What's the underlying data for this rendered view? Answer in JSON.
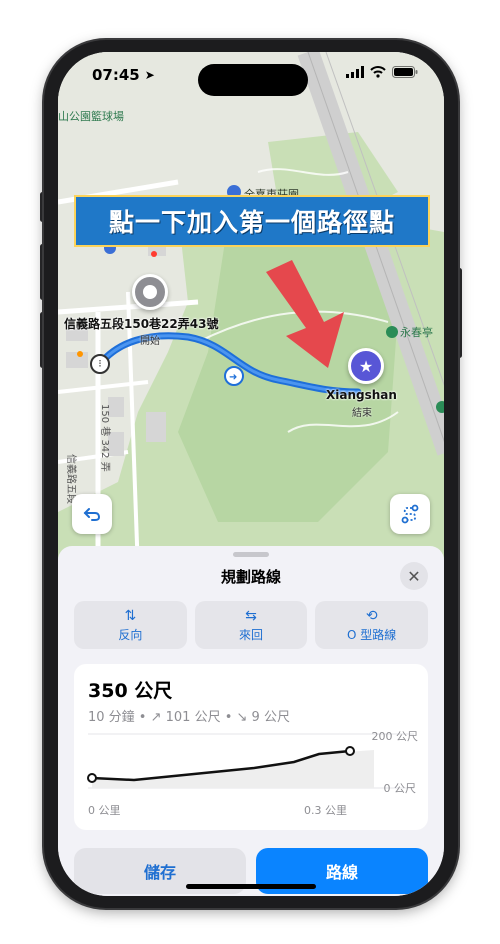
{
  "status_bar": {
    "time": "07:45"
  },
  "map": {
    "labels": {
      "court": "山公園籃球場",
      "park": "全嘉東莊園",
      "pavilion": "永春亭",
      "street_a": "150 巷 342 弄",
      "street_b": "信義路五段"
    },
    "start": {
      "name": "信義路五段150巷22弄43號",
      "sub": "開始"
    },
    "end": {
      "name": "Xiangshan",
      "sub": "結束"
    }
  },
  "banner": {
    "text": "點一下加入第一個路徑點"
  },
  "sheet": {
    "title": "規劃路線",
    "options": [
      {
        "icon": "⇅",
        "label": "反向"
      },
      {
        "icon": "⇆",
        "label": "來回"
      },
      {
        "icon": "⟲",
        "label": "O 型路線"
      }
    ],
    "distance": "350 公尺",
    "stats": "10 分鐘 • ↗ 101 公尺 • ↘ 9 公尺",
    "elevation": {
      "top_label": "200 公尺",
      "bottom_label": "0 公尺",
      "x_start": "0 公里",
      "x_end": "0.3 公里"
    },
    "save_label": "儲存",
    "route_label": "路線"
  },
  "colors": {
    "accent": "#0a84ff",
    "route_line": "#1e6fd9",
    "banner_bg": "#1f78c8",
    "end_pin": "#5856d6",
    "arrow": "#e5484d"
  }
}
